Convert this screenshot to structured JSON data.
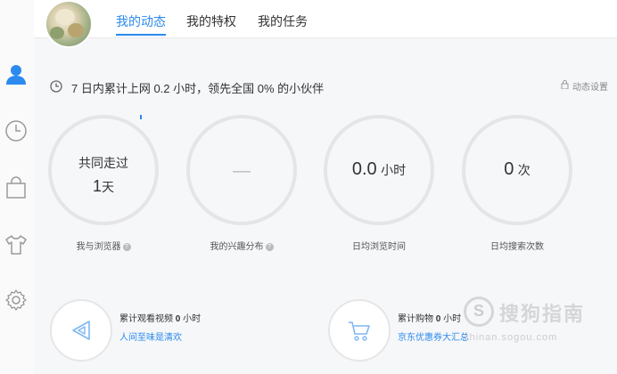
{
  "tabs": {
    "dynamic": "我的动态",
    "privileges": "我的特权",
    "tasks": "我的任务"
  },
  "summary": {
    "text": "7 日内累计上网 0.2 小时，领先全国 0% 的小伙伴",
    "settings": "动态设置"
  },
  "stats": {
    "together": {
      "line1": "共同走过",
      "value": "1",
      "unit": "天",
      "label": "我与浏览器"
    },
    "interest": {
      "value": "—",
      "label": "我的兴趣分布"
    },
    "browse_time": {
      "value": "0.0",
      "unit": "小时",
      "label": "日均浏览时间"
    },
    "search_count": {
      "value": "0",
      "unit": "次",
      "label": "日均搜索次数"
    }
  },
  "cards": {
    "video": {
      "prefix": "累计观看视频",
      "value": "0",
      "unit": "小时",
      "link": "人间至味是清欢"
    },
    "shopping": {
      "prefix": "累计购物",
      "value": "0",
      "unit": "小时",
      "link": "京东优惠券大汇总"
    }
  },
  "watermark": {
    "brand": "搜狗指南",
    "url": "zhinan.sogou.com"
  },
  "colors": {
    "accent": "#2b8aed",
    "sidebar_active": "#2b8aed",
    "sidebar_icon": "#999999"
  },
  "icons": {
    "sidebar": [
      "user-icon",
      "clock-icon",
      "shopping-bag-icon",
      "shirt-icon",
      "gear-icon"
    ],
    "help": "?"
  }
}
